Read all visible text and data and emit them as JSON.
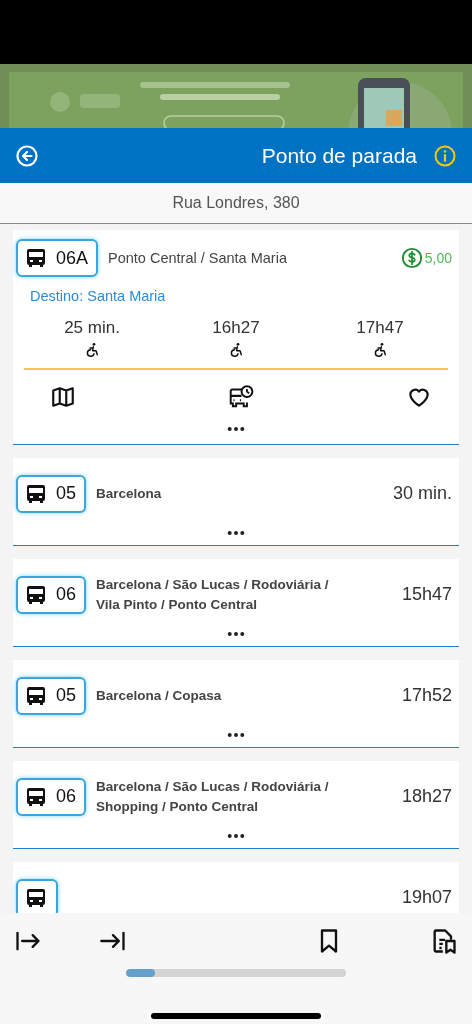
{
  "header": {
    "title": "Ponto de parada"
  },
  "address": "Rua Londres, 380",
  "routes": [
    {
      "code": "06A",
      "name": "Ponto Central / Santa Maria",
      "expanded": true,
      "fare": "5,00",
      "destination": "Destino: Santa Maria",
      "departures": [
        {
          "time": "25 min.",
          "accessible": true
        },
        {
          "time": "16h27",
          "accessible": true
        },
        {
          "time": "17h47",
          "accessible": true
        }
      ]
    },
    {
      "code": "05",
      "name": "Barcelona",
      "expanded": false,
      "time": "30 min."
    },
    {
      "code": "06",
      "name": "Barcelona / São Lucas / Rodoviária / Vila Pinto / Ponto Central",
      "expanded": false,
      "time": "15h47"
    },
    {
      "code": "05",
      "name": "Barcelona / Copasa",
      "expanded": false,
      "time": "17h52"
    },
    {
      "code": "06",
      "name": "Barcelona / São Lucas / Rodoviária / Shopping / Ponto Central",
      "expanded": false,
      "time": "18h27"
    },
    {
      "expanded": false,
      "time": "19h07"
    }
  ]
}
